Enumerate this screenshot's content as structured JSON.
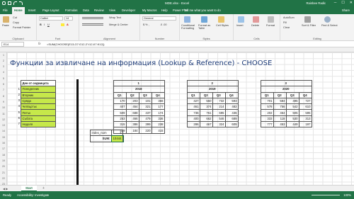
{
  "window": {
    "title": "MDE.xlsx - Excel",
    "user": "Rainbee Radic",
    "controls": [
      "─",
      "☐",
      "✕"
    ]
  },
  "ribbon_tabs": [
    "File",
    "Home",
    "Insert",
    "Page Layout",
    "Formulas",
    "Data",
    "Review",
    "View",
    "Developer",
    "My Macros",
    "Help",
    "Power Pivot"
  ],
  "tell_me": "Tell me what you want to do",
  "share": "Share",
  "ribbon": {
    "clipboard": {
      "paste": "Paste",
      "cut": "Cut",
      "copy": "Copy",
      "format_painter": "Format Painter",
      "label": "Clipboard"
    },
    "font": {
      "name": "Calibri",
      "size": "14",
      "label": "Font"
    },
    "alignment": {
      "wrap": "Wrap Text",
      "merge": "Merge & Center",
      "label": "Alignment"
    },
    "number": {
      "format": "General",
      "label": "Number"
    },
    "styles": {
      "conditional": "Conditional Formatting",
      "format_table": "Format as Table",
      "cell_styles": "Cell Styles",
      "label": "Styles"
    },
    "cells": {
      "insert": "Insert",
      "delete": "Delete",
      "format": "Format",
      "label": "Cells"
    },
    "editing": {
      "autosum": "AutoSum",
      "fill": "Fill",
      "clear": "Clear",
      "sort": "Sort & Filter",
      "find": "Find & Select",
      "label": "Editing"
    }
  },
  "formula_bar": {
    "name_box": "E14",
    "fx": "fx",
    "formula": "=SUM(CHOOSE(E13,G7:G12,I7:I12,K7:K12))"
  },
  "sheet": {
    "title": "Функции за извличане на информация (Lookup & Reference) - CHOOSE",
    "day_header": "Ден от седмицата",
    "days": [
      {
        "n": "1",
        "name": "Понеделник"
      },
      {
        "n": "2",
        "name": "Вторник"
      },
      {
        "n": "3",
        "name": "Сряда"
      },
      {
        "n": "4",
        "name": "Четвъртък"
      },
      {
        "n": "5",
        "name": "Петък"
      },
      {
        "n": "6",
        "name": "Събота"
      },
      {
        "n": "7",
        "name": "Неделя"
      }
    ],
    "tables": [
      {
        "index": "1",
        "year": "2018",
        "quarters": [
          "Q1",
          "Q2",
          "Q3",
          "Q4"
        ],
        "rows": [
          [
            "170",
            "203",
            "101",
            "366"
          ],
          [
            "407",
            "454",
            "321",
            "177"
          ],
          [
            "509",
            "688",
            "437",
            "174"
          ],
          [
            "253",
            "466",
            "479",
            "336"
          ],
          [
            "315",
            "386",
            "399",
            "238"
          ],
          [
            "439",
            "184",
            "220",
            "415"
          ]
        ]
      },
      {
        "index": "2",
        "year": "2019",
        "quarters": [
          "Q1",
          "Q2",
          "Q3",
          "Q4"
        ],
        "rows": [
          [
            "427",
            "550",
            "732",
            "593"
          ],
          [
            "461",
            "374",
            "214",
            "482"
          ],
          [
            "736",
            "761",
            "695",
            "436"
          ],
          [
            "400",
            "662",
            "546",
            "689"
          ],
          [
            "286",
            "467",
            "324",
            "609"
          ],
          [
            "",
            "",
            "",
            ""
          ]
        ]
      },
      {
        "index": "3",
        "year": "2020",
        "quarters": [
          "Q1",
          "Q2",
          "Q3",
          "Q4"
        ],
        "rows": [
          [
            "701",
            "584",
            "495",
            "727"
          ],
          [
            "578",
            "756",
            "542",
            "610"
          ],
          [
            "202",
            "464",
            "505",
            "595"
          ],
          [
            "333",
            "118",
            "530",
            "313"
          ],
          [
            "777",
            "453",
            "449",
            "197"
          ],
          [
            "",
            "",
            "",
            ""
          ]
        ]
      }
    ],
    "index_label": "index_num",
    "index_value": "2",
    "sum_label": "SUM:",
    "sum_value": "10444",
    "row_numbers": [
      "1",
      "2",
      "3",
      "4",
      "5",
      "6",
      "7",
      "8",
      "9",
      "10",
      "11",
      "12",
      "13",
      "14",
      "15",
      "16",
      "17",
      "18",
      "19",
      "20",
      "21",
      "22",
      "23"
    ]
  },
  "sheet_tabs": {
    "active": "Start",
    "add": "+"
  },
  "status": {
    "ready": "Ready",
    "accessibility": "Accessibility: Investigate",
    "zoom": "100%"
  },
  "colors": {
    "excel_green": "#217346",
    "highlight": "#c6e84a",
    "title_blue": "#1f3d7a"
  }
}
